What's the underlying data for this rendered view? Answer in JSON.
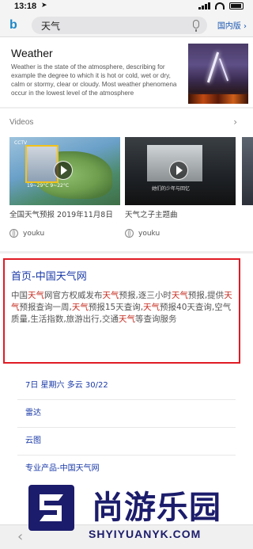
{
  "status": {
    "time": "13:18",
    "location_arrow": "➤"
  },
  "search": {
    "query": "天气",
    "region": "国内版",
    "region_chevron": "›"
  },
  "weather_card": {
    "title": "Weather",
    "description": "Weather is the state of the atmosphere, describing for example the degree to which it is hot or cold, wet or dry, calm or stormy, clear or cloudy. Most weather phenomena occur in the lowest level of the atmosphere"
  },
  "videos": {
    "heading": "Videos",
    "chevron": "›",
    "items": [
      {
        "tag": "CCTV",
        "caption": "19~29°C  9~22°C",
        "title": "全国天气预报 2019年11月8日",
        "source": "youku"
      },
      {
        "subtitle": "她们的少年与回忆",
        "title": "天气之子主题曲",
        "source": "youku"
      }
    ]
  },
  "result": {
    "title": "首页-中国天气网",
    "snippet_parts": [
      {
        "t": "中国",
        "h": false
      },
      {
        "t": "天气",
        "h": true
      },
      {
        "t": "网官方权威发布",
        "h": false
      },
      {
        "t": "天气",
        "h": true
      },
      {
        "t": "预报,逐三小时",
        "h": false
      },
      {
        "t": "天气",
        "h": true
      },
      {
        "t": "预报,提供",
        "h": false
      },
      {
        "t": "天气",
        "h": true
      },
      {
        "t": "预报查询一周,",
        "h": false
      },
      {
        "t": "天气",
        "h": true
      },
      {
        "t": "预报15天查询,",
        "h": false
      },
      {
        "t": "天气",
        "h": true
      },
      {
        "t": "预报40天查询,空气质量,生活指数,旅游出行,交通",
        "h": false
      },
      {
        "t": "天气",
        "h": true
      },
      {
        "t": "等查询服务",
        "h": false
      }
    ],
    "sublinks": [
      "7日 星期六 多云 30/22",
      "雷达",
      "云图",
      "专业产品-中国天气网"
    ]
  },
  "nav": {
    "back": "‹"
  },
  "watermark": {
    "cn": "尚游乐园",
    "en": "SHYIYUANYK.COM"
  },
  "colors": {
    "link": "#1a3aa8",
    "highlight": "#c4281c",
    "redbox": "#e01b24",
    "watermark": "#1c1c6c"
  }
}
